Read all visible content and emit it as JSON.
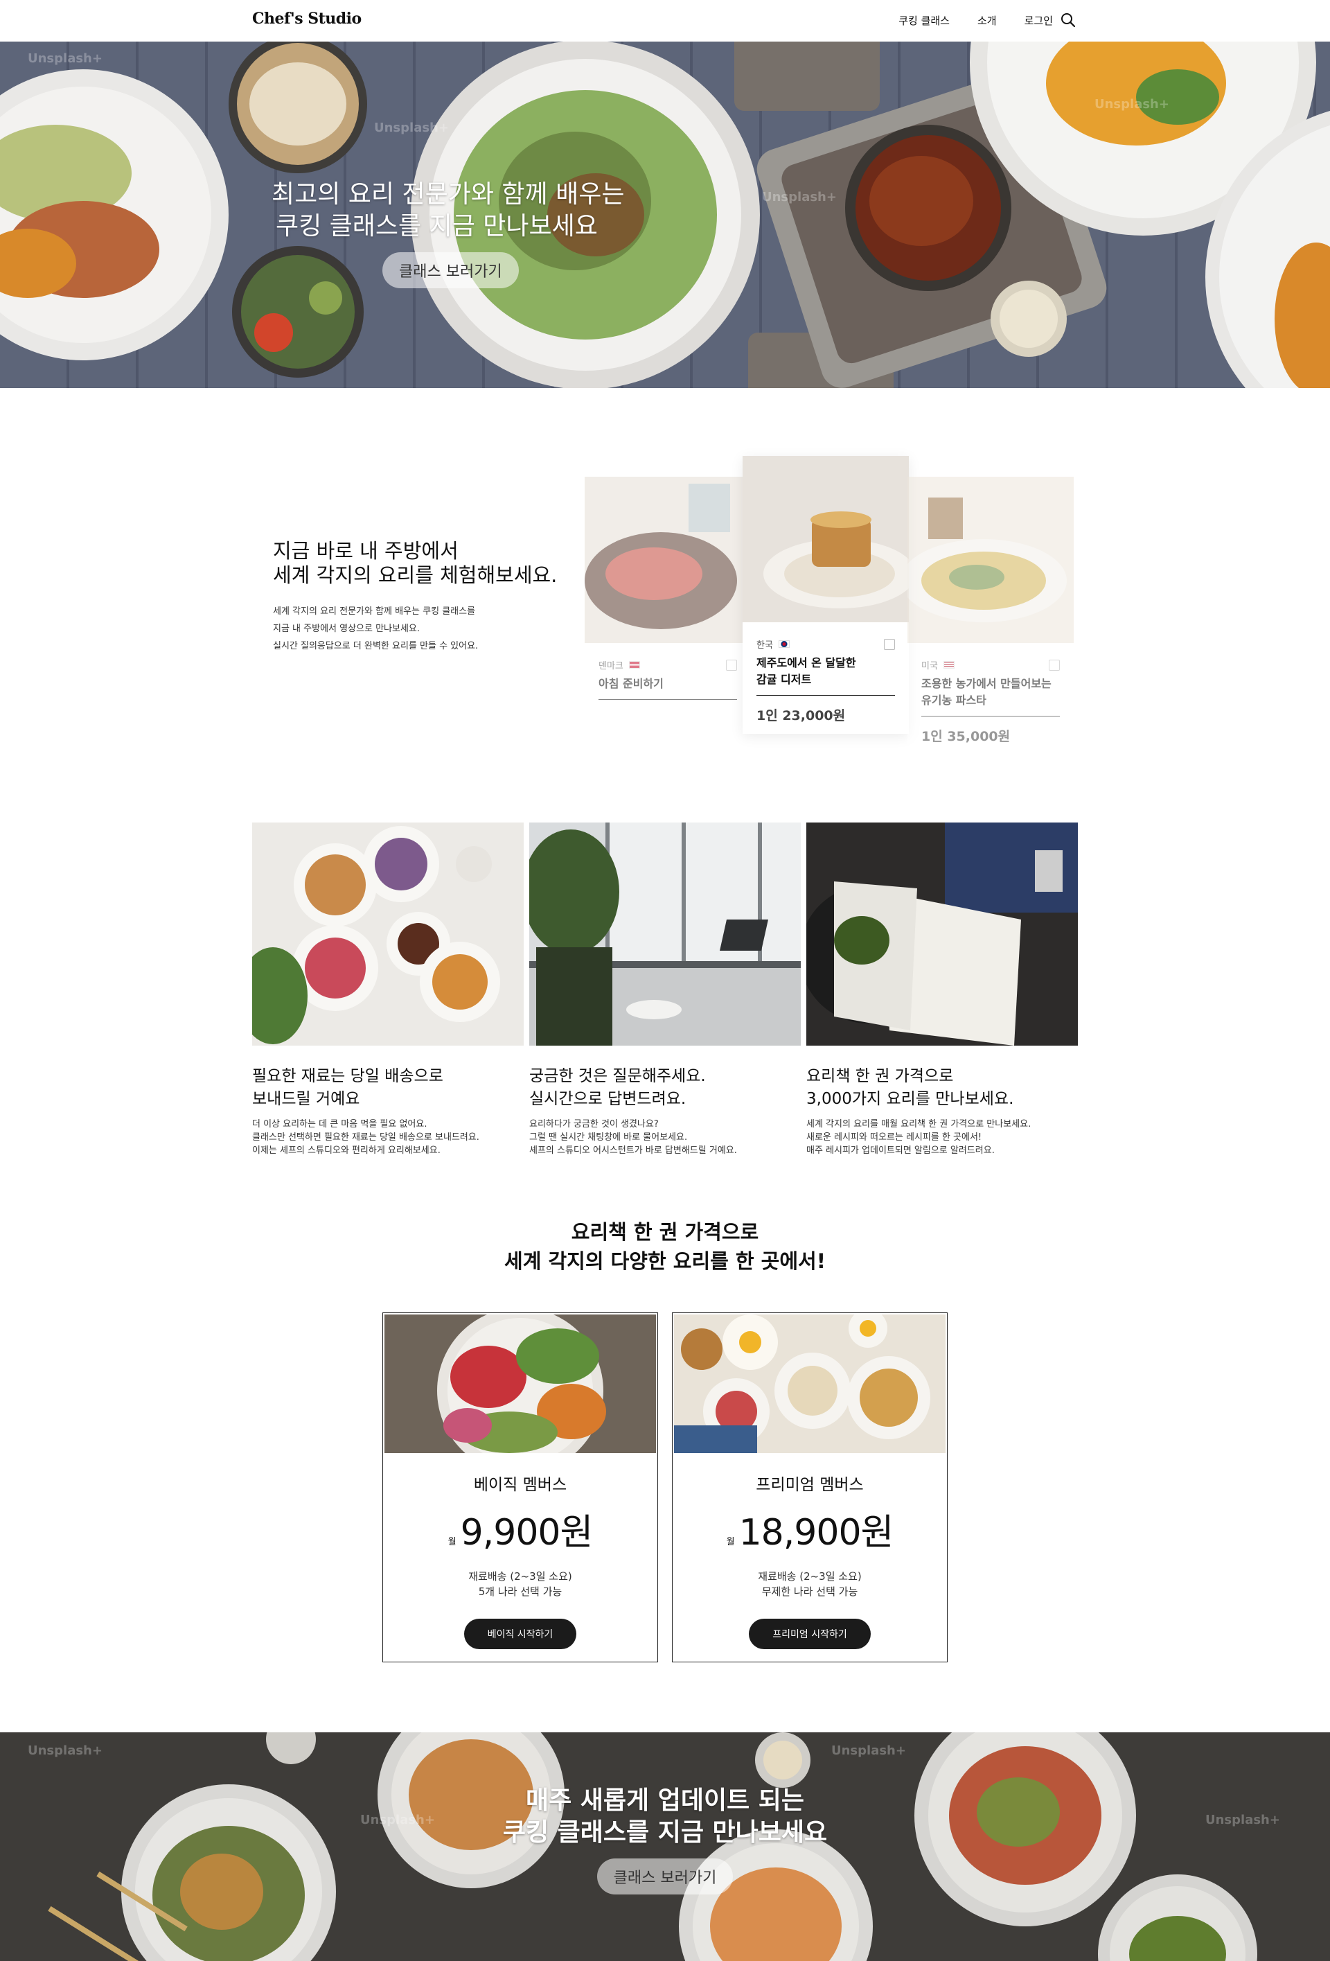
{
  "header": {
    "logo": "Chef's Studio",
    "nav": [
      "쿠킹 클래스",
      "소개",
      "로그인"
    ],
    "search_icon": "search-icon"
  },
  "hero": {
    "title_line1": "최고의 요리 전문가와 함께 배우는",
    "title_line2": "쿠킹 클래스를 지금 만나보세요",
    "button": "클래스 보러가기",
    "watermark": "Unsplash+"
  },
  "intro": {
    "title_line1": "지금 바로 내 주방에서",
    "title_line2": "세계 각지의 요리를 체험해보세요.",
    "desc_line1": "세계 각지의 요리 전문가와 함께 배우는 쿠킹 클래스를",
    "desc_line2": "지금 내 주방에서 영상으로 만나보세요.",
    "desc_line3": "실시간 질의응답으로 더 완벽한 요리를 만들 수 있어요."
  },
  "classes": [
    {
      "country": "덴마크",
      "title_line1": "아침 준비하기",
      "title_line2": "",
      "price": ""
    },
    {
      "country": "한국",
      "title_line1": "제주도에서 온 달달한",
      "title_line2": "감귤 디저트",
      "price": "1인 23,000원"
    },
    {
      "country": "미국",
      "title_line1": "조용한 농가에서 만들어보는",
      "title_line2": "유기농 파스타",
      "price": "1인 35,000원"
    }
  ],
  "features": [
    {
      "title_line1": "필요한 재료는 당일 배송으로",
      "title_line2": "보내드릴 거예요",
      "desc": [
        "더 이상 요리하는 데 큰 마음 먹을 필요 없어요.",
        "클래스만 선택하면 필요한 재료는 당일 배송으로 보내드려요.",
        "이제는 셰프의 스튜디오와 편리하게 요리해보세요."
      ]
    },
    {
      "title_line1": "궁금한 것은 질문해주세요.",
      "title_line2": "실시간으로 답변드려요.",
      "desc": [
        "요리하다가 궁금한 것이 생겼나요?",
        "그럴 땐 실시간 채팅창에 바로 물어보세요.",
        "셰프의 스튜디오 어시스턴트가 바로 답변해드릴 거예요."
      ]
    },
    {
      "title_line1": "요리책 한 권 가격으로",
      "title_line2": "3,000가지 요리를 만나보세요.",
      "desc": [
        "세계 각지의 요리를 매월 요리책 한 권 가격으로 만나보세요.",
        "새로운 레시피와 떠오르는 레시피를 한 곳에서!",
        "매주 레시피가 업데이트되면 알림으로 알려드려요."
      ]
    }
  ],
  "pricing": {
    "title_line1": "요리책 한 권 가격으로",
    "title_line2": "세계 각지의 다양한 요리를 한 곳에서!",
    "plans": [
      {
        "name": "베이직 멤버스",
        "unit": "월",
        "amount": "9,900원",
        "f1": "재료배송 (2~3일 소요)",
        "f2": "5개 나라 선택 가능",
        "cta": "베이직 시작하기"
      },
      {
        "name": "프리미엄 멤버스",
        "unit": "월",
        "amount": "18,900원",
        "f1": "재료배송 (2~3일 소요)",
        "f2": "무제한 나라 선택 가능",
        "cta": "프리미엄 시작하기"
      }
    ]
  },
  "banner": {
    "title_line1": "매주 새롭게 업데이트 되는",
    "title_line2": "쿠킹 클래스를 지금 만나보세요",
    "button": "클래스 보러가기",
    "watermark": "Unsplash+"
  }
}
